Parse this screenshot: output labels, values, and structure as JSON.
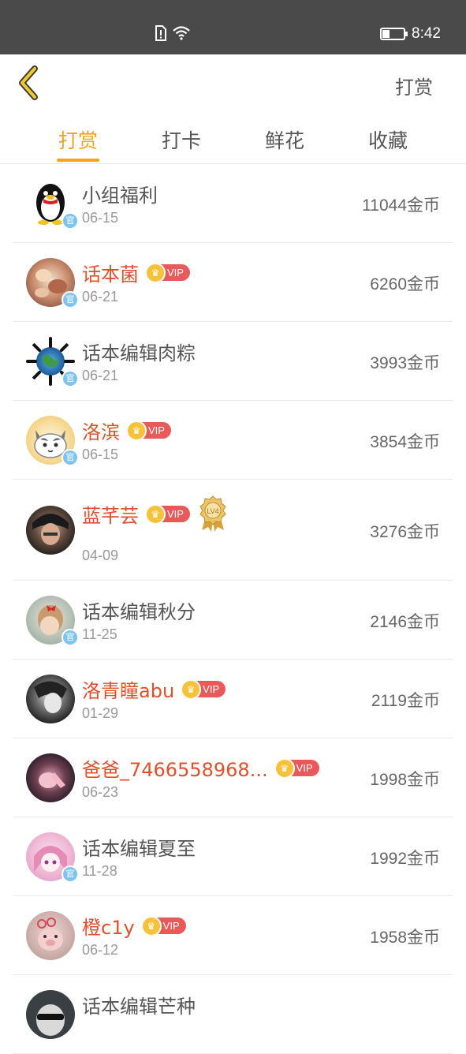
{
  "status_bar": {
    "time": "8:42",
    "icons": [
      "sim-alert-icon",
      "wifi-icon",
      "battery-icon"
    ]
  },
  "header": {
    "back_icon": "chevron-left-icon",
    "action_label": "打赏"
  },
  "tabs": [
    {
      "label": "打赏",
      "active": true
    },
    {
      "label": "打卡",
      "active": false
    },
    {
      "label": "鲜花",
      "active": false
    },
    {
      "label": "收藏",
      "active": false
    }
  ],
  "colors": {
    "accent": "#f2a31c",
    "vip_name": "#e1502d",
    "vip_badge": "#e8595a",
    "status_bar": "#4a4a4a"
  },
  "vip_label": "VIP",
  "medal_label": "LV4",
  "official_badge_label": "官",
  "rewards": [
    {
      "name": "小组福利",
      "date": "06-15",
      "amount": "11044金币",
      "vip": false,
      "official": true,
      "avatar": "penguin"
    },
    {
      "name": "话本菌",
      "date": "06-21",
      "amount": "6260金币",
      "vip": true,
      "official": true,
      "avatar": "sweets"
    },
    {
      "name": "话本编辑肉粽",
      "date": "06-21",
      "amount": "3993金币",
      "vip": false,
      "official": true,
      "avatar": "earth"
    },
    {
      "name": "洛滨",
      "date": "06-15",
      "amount": "3854金币",
      "vip": true,
      "official": true,
      "avatar": "cat"
    },
    {
      "name": "蓝芊芸",
      "date": "04-09",
      "amount": "3276金币",
      "vip": true,
      "official": false,
      "medal": true,
      "avatar": "dark-portrait"
    },
    {
      "name": "话本编辑秋分",
      "date": "11-25",
      "amount": "2146金币",
      "vip": false,
      "official": true,
      "avatar": "girl-bow"
    },
    {
      "name": "洛青瞳abu",
      "date": "01-29",
      "amount": "2119金币",
      "vip": true,
      "official": false,
      "avatar": "mono-portrait"
    },
    {
      "name": "爸爸_7466558968...",
      "date": "06-23",
      "amount": "1998金币",
      "vip": true,
      "official": false,
      "avatar": "pink-dark"
    },
    {
      "name": "话本编辑夏至",
      "date": "11-28",
      "amount": "1992金币",
      "vip": false,
      "official": true,
      "avatar": "anime-girl"
    },
    {
      "name": "橙c1y",
      "date": "06-12",
      "amount": "1958金币",
      "vip": true,
      "official": false,
      "avatar": "pig"
    },
    {
      "name": "话本编辑芒种",
      "date": "",
      "amount": "",
      "vip": false,
      "official": false,
      "avatar": "sunglasses"
    }
  ]
}
